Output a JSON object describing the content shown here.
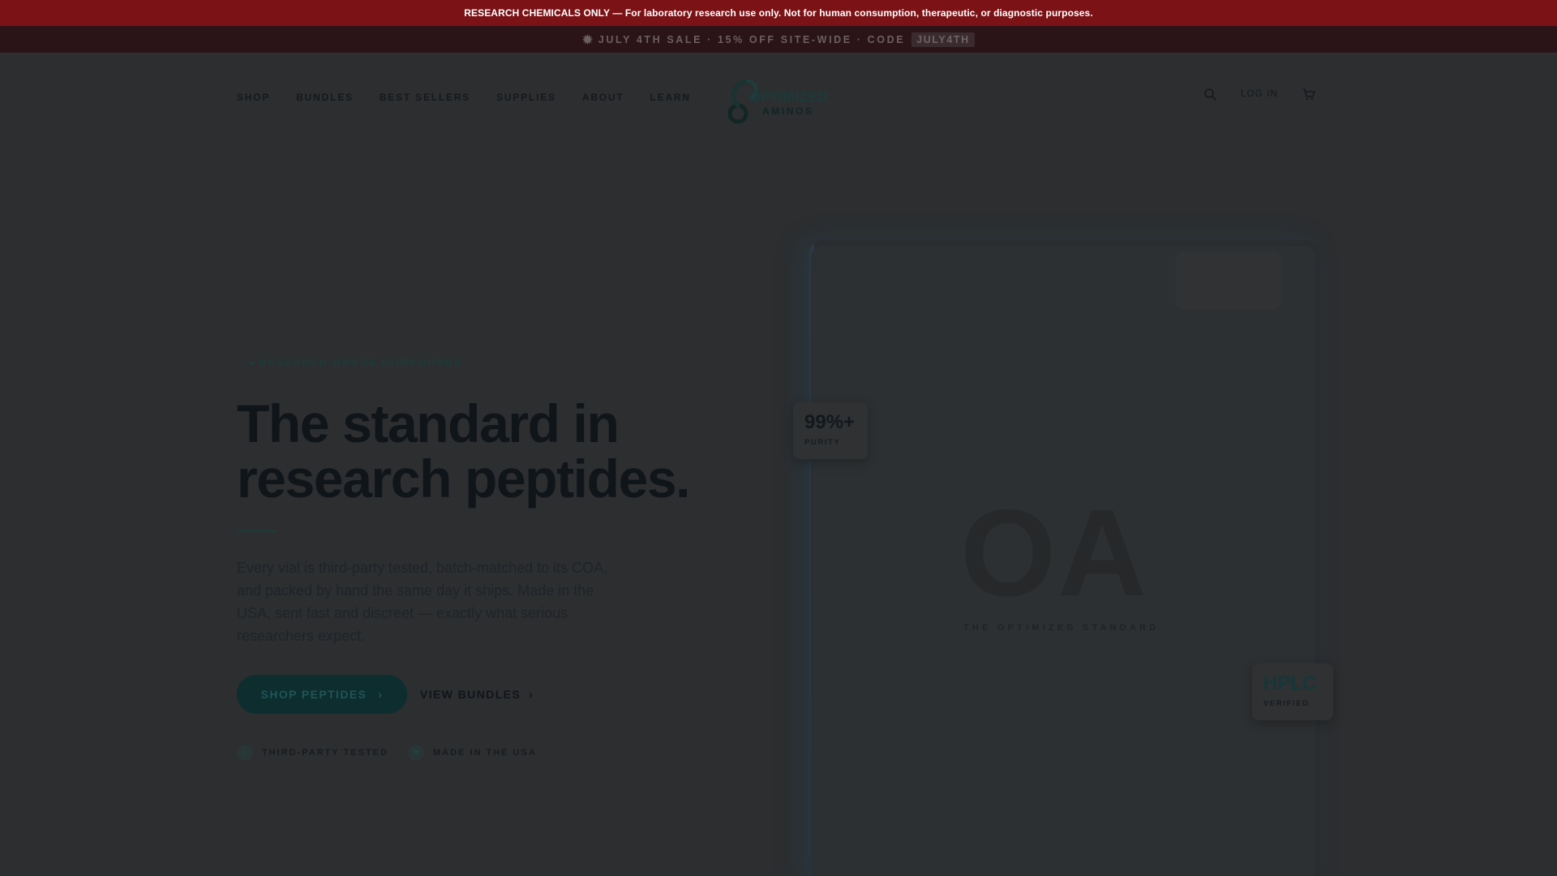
{
  "disclaimer": {
    "text": "RESEARCH CHEMICALS ONLY — For laboratory research use only. Not for human consumption, therapeutic, or diagnostic purposes."
  },
  "promo": {
    "icon": "sparkle-icon",
    "text": "JULY 4TH SALE · 15% OFF SITE-WIDE · CODE",
    "code": "JULY4TH"
  },
  "nav": {
    "items": [
      {
        "label": "SHOP"
      },
      {
        "label": "BUNDLES"
      },
      {
        "label": "BEST SELLERS"
      },
      {
        "label": "SUPPLIES"
      },
      {
        "label": "ABOUT"
      },
      {
        "label": "LEARN"
      }
    ],
    "login": "LOG IN"
  },
  "logo": {
    "line1": "OPTIMIZED",
    "line2": "AMINOS"
  },
  "hero": {
    "eyebrow": "RESEARCH-GRADE COMPOUNDS",
    "title_line1": "The standard in",
    "title_line2": "research peptides.",
    "lede": "Every vial is third-party tested, batch-matched to its COA, and packed by hand the same day it ships. Made in the USA, sent fast and discreet — exactly what serious researchers expect.",
    "primary_cta": "SHOP PEPTIDES",
    "secondary_cta": "VIEW BUNDLES",
    "badges": [
      {
        "label": "THIRD-PARTY TESTED",
        "icon": "check-shield-icon"
      },
      {
        "label": "MADE IN THE USA",
        "icon": "flag-icon"
      }
    ]
  },
  "visual": {
    "monogram": "OA",
    "tagline": "THE OPTIMIZED STANDARD",
    "purity_value": "99%+",
    "purity_label": "PURITY",
    "hplc_value": "HPLC",
    "hplc_label": "VERIFIED"
  },
  "colors": {
    "disclaimer_bg": "#7a1216",
    "promo_bg": "#2b1418",
    "accent_teal": "#0d2d2e",
    "page_overlay": "#2c2e30"
  }
}
